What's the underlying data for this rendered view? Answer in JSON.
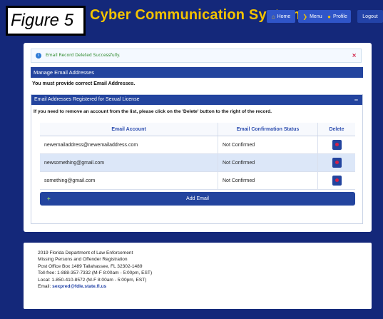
{
  "figure_label": "Figure 5",
  "app": {
    "title": "Cyber Communication System"
  },
  "nav": [
    {
      "label": "Home",
      "icon": "home-icon"
    },
    {
      "label": "Menu",
      "icon": "chevron-right-icon"
    },
    {
      "label": "Profile",
      "icon": "user-icon"
    },
    {
      "label": "Logout",
      "icon": ""
    }
  ],
  "alert": {
    "message": "Email Record Deleted Successfully.",
    "close": "×"
  },
  "manage": {
    "title": "Manage Email Addresses",
    "notice": "You must provide correct Email Addresses."
  },
  "section": {
    "title": "Email Addresses Registered for Sexual License",
    "collapse": "−",
    "instruction": "If you need to remove an account from the list, please click on the 'Delete' button to the right of the record."
  },
  "table": {
    "headers": [
      "Email Account",
      "Email Confirmation Status",
      "Delete"
    ],
    "rows": [
      {
        "email": "newemailaddress@newemailaddress.com",
        "status": "Not Confirmed"
      },
      {
        "email": "newsomething@gmail.com",
        "status": "Not Confirmed"
      },
      {
        "email": "something@gmail.com",
        "status": "Not Confirmed"
      }
    ]
  },
  "add_email": {
    "label": "Add Email",
    "icon": "+"
  },
  "footer": {
    "line1": "2019 Florida Department of Law Enforcement",
    "line2": "Missing Persons and Offender Registration",
    "line3": "Post Office Box 1489 Tallahassee, FL 32302-1489",
    "line4": "Toll-free: 1-888-357-7332 (M-F 8:00am - 5:00pm, EST)",
    "line5": "Local: 1-850-410-8572 (M-F 8:00am - 5:00pm, EST)",
    "email_label": "Email: ",
    "email": "sexpred@fdle.state.fl.us"
  },
  "colors": {
    "background": "#14287a",
    "accent": "#23449e",
    "title": "#f2c200",
    "success": "#2e8b2e",
    "danger": "#d42048"
  }
}
